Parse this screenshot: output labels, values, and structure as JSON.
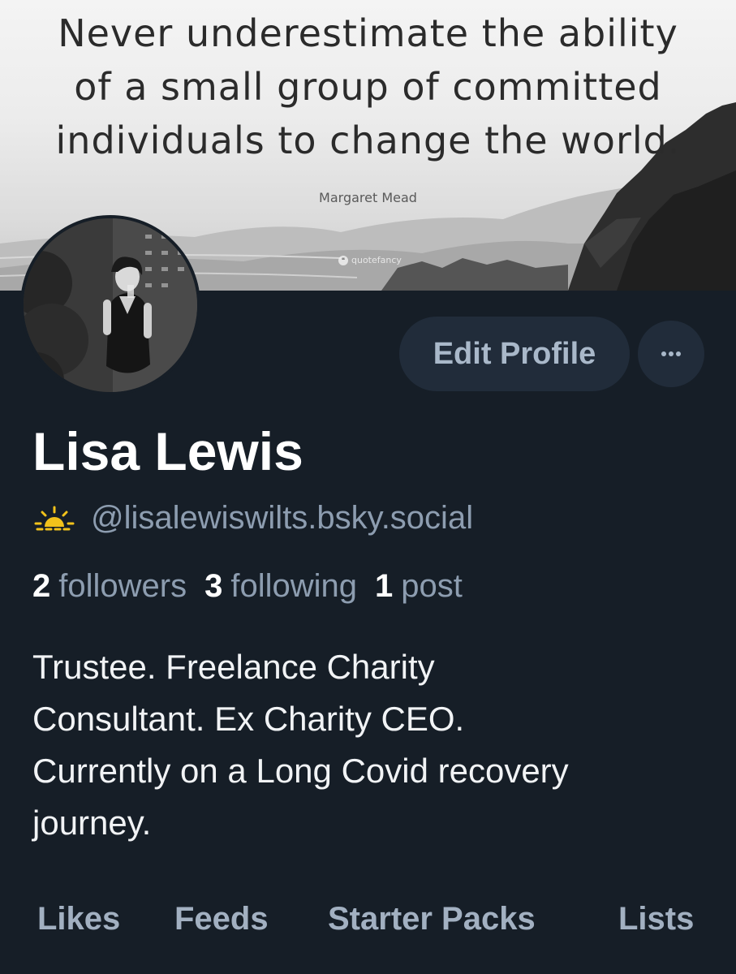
{
  "banner": {
    "quote_lines": [
      "Never underestimate the ability",
      "of a small group of committed",
      "individuals to change the world."
    ],
    "author": "Margaret Mead",
    "watermark": "quotefancy"
  },
  "profile": {
    "name": "Lisa Lewis",
    "handle_emoji": "sunrise-icon",
    "handle": "@lisalewiswilts.bsky.social",
    "followers_count": "2",
    "followers_label": "followers",
    "following_count": "3",
    "following_label": "following",
    "posts_count": "1",
    "posts_label": "post",
    "bio_lines": [
      "Trustee. Freelance Charity",
      "Consultant. Ex Charity CEO.",
      "Currently on a Long Covid recovery",
      "journey."
    ]
  },
  "actions": {
    "edit_label": "Edit Profile",
    "more_icon": "ellipsis-icon"
  },
  "tabs": [
    {
      "label": "Likes"
    },
    {
      "label": "Feeds"
    },
    {
      "label": "Starter Packs"
    },
    {
      "label": "Lists"
    }
  ],
  "colors": {
    "background": "#161e27",
    "button_bg": "#212c3a",
    "muted_text": "#8d9db0",
    "sun_icon": "#f2c21b"
  }
}
